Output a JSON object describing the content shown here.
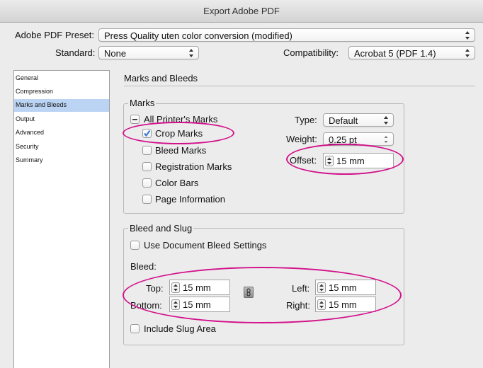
{
  "window": {
    "title": "Export Adobe PDF"
  },
  "header": {
    "preset_label": "Adobe PDF Preset:",
    "preset_value": "Press Quality uten color conversion (modified)",
    "standard_label": "Standard:",
    "standard_value": "None",
    "compat_label": "Compatibility:",
    "compat_value": "Acrobat 5 (PDF 1.4)"
  },
  "sidebar": {
    "items": [
      {
        "label": "General"
      },
      {
        "label": "Compression"
      },
      {
        "label": "Marks and Bleeds",
        "selected": true
      },
      {
        "label": "Output"
      },
      {
        "label": "Advanced"
      },
      {
        "label": "Security"
      },
      {
        "label": "Summary"
      }
    ]
  },
  "main": {
    "section_title": "Marks and Bleeds",
    "marks": {
      "legend": "Marks",
      "all_printers": {
        "label": "All Printer's Marks",
        "state": "mixed"
      },
      "crop_marks": {
        "label": "Crop Marks",
        "checked": true
      },
      "bleed_marks": {
        "label": "Bleed Marks",
        "checked": false
      },
      "registration_marks": {
        "label": "Registration Marks",
        "checked": false
      },
      "color_bars": {
        "label": "Color Bars",
        "checked": false
      },
      "page_information": {
        "label": "Page Information",
        "checked": false
      },
      "type_label": "Type:",
      "type_value": "Default",
      "weight_label": "Weight:",
      "weight_value": "0.25 pt",
      "offset_label": "Offset:",
      "offset_value": "15 mm"
    },
    "bleed": {
      "legend": "Bleed and Slug",
      "use_document": {
        "label": "Use Document Bleed Settings",
        "checked": false
      },
      "bleed_label": "Bleed:",
      "top_label": "Top:",
      "top_value": "15 mm",
      "bottom_label": "Bottom:",
      "bottom_value": "15 mm",
      "left_label": "Left:",
      "left_value": "15 mm",
      "right_label": "Right:",
      "right_value": "15 mm",
      "include_slug": {
        "label": "Include Slug Area",
        "checked": false
      }
    }
  },
  "colors": {
    "highlight": "#d2128b",
    "sidebar_selected": "#bcd4f3",
    "checkbox_accent": "#3c7bd6"
  }
}
